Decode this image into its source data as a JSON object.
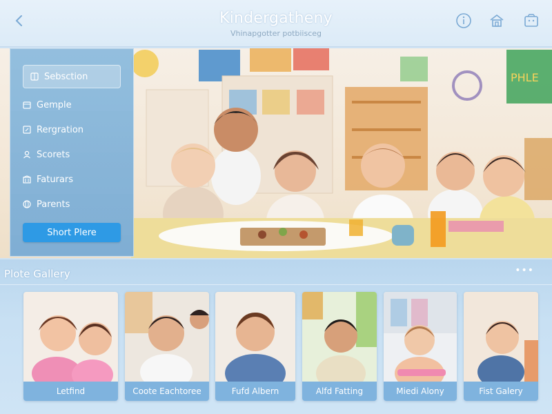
{
  "header": {
    "title": "Kindergatheny",
    "subtitle": "Vhinapgotter potbiisceg",
    "icons": [
      "back-arrow-icon",
      "info-icon",
      "home-icon",
      "gallery-icon"
    ]
  },
  "sidebar": {
    "items": [
      {
        "label": "Sebsction",
        "icon": "grid-icon",
        "selected": true
      },
      {
        "label": "Gemple",
        "icon": "calendar-icon"
      },
      {
        "label": "Rergration",
        "icon": "edit-icon"
      },
      {
        "label": "Scorets",
        "icon": "user-icon"
      },
      {
        "label": "Faturars",
        "icon": "building-icon"
      },
      {
        "label": "Parents",
        "icon": "globe-icon"
      }
    ],
    "cta_label": "Short Plere"
  },
  "gallery": {
    "title": "Plote Gallery",
    "more_label": "•••",
    "cards": [
      {
        "caption": "Letfind"
      },
      {
        "caption": "Coote Eachtoree"
      },
      {
        "caption": "Fufd Albern"
      },
      {
        "caption": "Alfd Fatting"
      },
      {
        "caption": "Miedi Alony"
      },
      {
        "caption": "Fist Galery"
      }
    ]
  },
  "colors": {
    "accent": "#2e9ae5",
    "sidebar": "#8bbadd",
    "gallery_bg": "#c8e0f3"
  }
}
